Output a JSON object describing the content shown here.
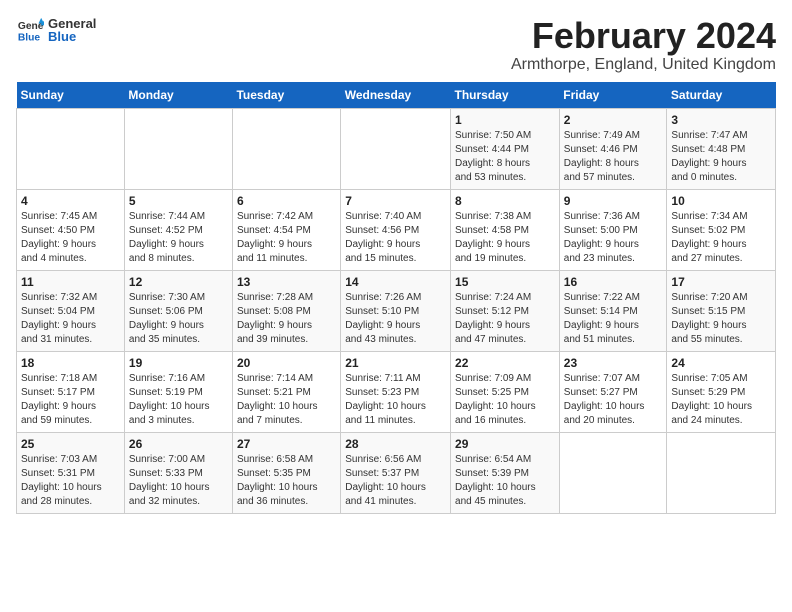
{
  "header": {
    "logo_general": "General",
    "logo_blue": "Blue",
    "month_year": "February 2024",
    "location": "Armthorpe, England, United Kingdom"
  },
  "days_of_week": [
    "Sunday",
    "Monday",
    "Tuesday",
    "Wednesday",
    "Thursday",
    "Friday",
    "Saturday"
  ],
  "weeks": [
    [
      {
        "num": "",
        "info": ""
      },
      {
        "num": "",
        "info": ""
      },
      {
        "num": "",
        "info": ""
      },
      {
        "num": "",
        "info": ""
      },
      {
        "num": "1",
        "info": "Sunrise: 7:50 AM\nSunset: 4:44 PM\nDaylight: 8 hours\nand 53 minutes."
      },
      {
        "num": "2",
        "info": "Sunrise: 7:49 AM\nSunset: 4:46 PM\nDaylight: 8 hours\nand 57 minutes."
      },
      {
        "num": "3",
        "info": "Sunrise: 7:47 AM\nSunset: 4:48 PM\nDaylight: 9 hours\nand 0 minutes."
      }
    ],
    [
      {
        "num": "4",
        "info": "Sunrise: 7:45 AM\nSunset: 4:50 PM\nDaylight: 9 hours\nand 4 minutes."
      },
      {
        "num": "5",
        "info": "Sunrise: 7:44 AM\nSunset: 4:52 PM\nDaylight: 9 hours\nand 8 minutes."
      },
      {
        "num": "6",
        "info": "Sunrise: 7:42 AM\nSunset: 4:54 PM\nDaylight: 9 hours\nand 11 minutes."
      },
      {
        "num": "7",
        "info": "Sunrise: 7:40 AM\nSunset: 4:56 PM\nDaylight: 9 hours\nand 15 minutes."
      },
      {
        "num": "8",
        "info": "Sunrise: 7:38 AM\nSunset: 4:58 PM\nDaylight: 9 hours\nand 19 minutes."
      },
      {
        "num": "9",
        "info": "Sunrise: 7:36 AM\nSunset: 5:00 PM\nDaylight: 9 hours\nand 23 minutes."
      },
      {
        "num": "10",
        "info": "Sunrise: 7:34 AM\nSunset: 5:02 PM\nDaylight: 9 hours\nand 27 minutes."
      }
    ],
    [
      {
        "num": "11",
        "info": "Sunrise: 7:32 AM\nSunset: 5:04 PM\nDaylight: 9 hours\nand 31 minutes."
      },
      {
        "num": "12",
        "info": "Sunrise: 7:30 AM\nSunset: 5:06 PM\nDaylight: 9 hours\nand 35 minutes."
      },
      {
        "num": "13",
        "info": "Sunrise: 7:28 AM\nSunset: 5:08 PM\nDaylight: 9 hours\nand 39 minutes."
      },
      {
        "num": "14",
        "info": "Sunrise: 7:26 AM\nSunset: 5:10 PM\nDaylight: 9 hours\nand 43 minutes."
      },
      {
        "num": "15",
        "info": "Sunrise: 7:24 AM\nSunset: 5:12 PM\nDaylight: 9 hours\nand 47 minutes."
      },
      {
        "num": "16",
        "info": "Sunrise: 7:22 AM\nSunset: 5:14 PM\nDaylight: 9 hours\nand 51 minutes."
      },
      {
        "num": "17",
        "info": "Sunrise: 7:20 AM\nSunset: 5:15 PM\nDaylight: 9 hours\nand 55 minutes."
      }
    ],
    [
      {
        "num": "18",
        "info": "Sunrise: 7:18 AM\nSunset: 5:17 PM\nDaylight: 9 hours\nand 59 minutes."
      },
      {
        "num": "19",
        "info": "Sunrise: 7:16 AM\nSunset: 5:19 PM\nDaylight: 10 hours\nand 3 minutes."
      },
      {
        "num": "20",
        "info": "Sunrise: 7:14 AM\nSunset: 5:21 PM\nDaylight: 10 hours\nand 7 minutes."
      },
      {
        "num": "21",
        "info": "Sunrise: 7:11 AM\nSunset: 5:23 PM\nDaylight: 10 hours\nand 11 minutes."
      },
      {
        "num": "22",
        "info": "Sunrise: 7:09 AM\nSunset: 5:25 PM\nDaylight: 10 hours\nand 16 minutes."
      },
      {
        "num": "23",
        "info": "Sunrise: 7:07 AM\nSunset: 5:27 PM\nDaylight: 10 hours\nand 20 minutes."
      },
      {
        "num": "24",
        "info": "Sunrise: 7:05 AM\nSunset: 5:29 PM\nDaylight: 10 hours\nand 24 minutes."
      }
    ],
    [
      {
        "num": "25",
        "info": "Sunrise: 7:03 AM\nSunset: 5:31 PM\nDaylight: 10 hours\nand 28 minutes."
      },
      {
        "num": "26",
        "info": "Sunrise: 7:00 AM\nSunset: 5:33 PM\nDaylight: 10 hours\nand 32 minutes."
      },
      {
        "num": "27",
        "info": "Sunrise: 6:58 AM\nSunset: 5:35 PM\nDaylight: 10 hours\nand 36 minutes."
      },
      {
        "num": "28",
        "info": "Sunrise: 6:56 AM\nSunset: 5:37 PM\nDaylight: 10 hours\nand 41 minutes."
      },
      {
        "num": "29",
        "info": "Sunrise: 6:54 AM\nSunset: 5:39 PM\nDaylight: 10 hours\nand 45 minutes."
      },
      {
        "num": "",
        "info": ""
      },
      {
        "num": "",
        "info": ""
      }
    ]
  ]
}
